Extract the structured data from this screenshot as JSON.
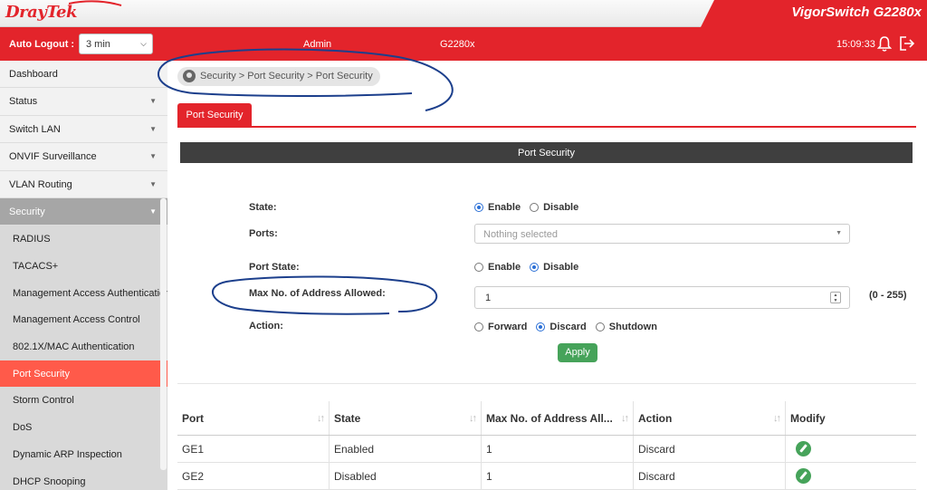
{
  "brand": {
    "logo": "DrayTek",
    "model_title": "VigorSwitch G2280x"
  },
  "header": {
    "auto_logout_label": "Auto Logout :",
    "auto_logout_value": "3 min",
    "user": "Admin",
    "model": "G2280x",
    "time": "15:09:33"
  },
  "sidebar": {
    "items": [
      {
        "label": "Dashboard"
      },
      {
        "label": "Status"
      },
      {
        "label": "Switch LAN"
      },
      {
        "label": "ONVIF Surveillance"
      },
      {
        "label": "VLAN Routing"
      },
      {
        "label": "Security"
      }
    ],
    "security_sub": [
      "RADIUS",
      "TACACS+",
      "Management Access Authentication",
      "Management Access Control",
      "802.1X/MAC Authentication",
      "Port Security",
      "Storm Control",
      "DoS",
      "Dynamic ARP Inspection",
      "DHCP Snooping"
    ]
  },
  "breadcrumb": "Security > Port Security  > Port Security",
  "tab": "Port Security",
  "panel_title": "Port Security",
  "form": {
    "state_label": "State:",
    "state_enable": "Enable",
    "state_disable": "Disable",
    "ports_label": "Ports:",
    "ports_placeholder": "Nothing selected",
    "port_state_label": "Port State:",
    "port_state_enable": "Enable",
    "port_state_disable": "Disable",
    "max_label": "Max No. of Address Allowed:",
    "max_value": "1",
    "max_range": "(0 - 255)",
    "action_label": "Action:",
    "action_forward": "Forward",
    "action_discard": "Discard",
    "action_shutdown": "Shutdown",
    "apply": "Apply"
  },
  "table": {
    "headers": [
      "Port",
      "State",
      "Max No. of Address All...",
      "Action",
      "Modify"
    ],
    "rows": [
      [
        "GE1",
        "Enabled",
        "1",
        "Discard"
      ],
      [
        "GE2",
        "Disabled",
        "1",
        "Discard"
      ]
    ]
  },
  "colors": {
    "brand_red": "#e3242b",
    "active_item": "#ff5a4a",
    "apply_green": "#46a35a",
    "annotation_ink": "#1c3f8c"
  }
}
